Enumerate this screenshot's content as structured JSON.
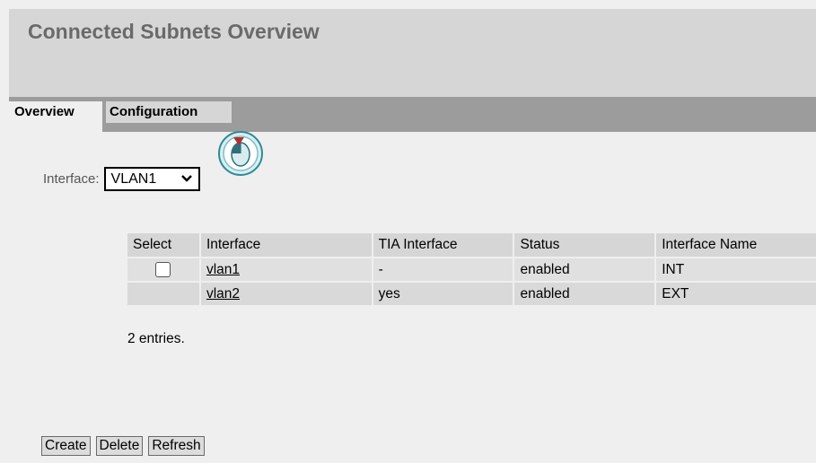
{
  "header": {
    "title": "Connected Subnets Overview"
  },
  "tabs": [
    {
      "label": "Overview",
      "active": true
    },
    {
      "label": "Configuration",
      "active": false
    }
  ],
  "interface_filter": {
    "label": "Interface:",
    "selected": "VLAN1"
  },
  "table": {
    "columns": [
      "Select",
      "Interface",
      "TIA Interface",
      "Status",
      "Interface Name"
    ],
    "rows": [
      {
        "interface": "vlan1",
        "tia": "-",
        "status": "enabled",
        "name": "INT",
        "has_checkbox": true
      },
      {
        "interface": "vlan2",
        "tia": "yes",
        "status": "enabled",
        "name": "EXT",
        "has_checkbox": false
      }
    ]
  },
  "entries_text": "2 entries.",
  "buttons": {
    "create": "Create",
    "delete": "Delete",
    "refresh": "Refresh"
  },
  "colors": {
    "header_bg": "#d6d6d6",
    "tabbar_bg": "#9c9c9c",
    "title": "#6a6a6a",
    "cursor_accent": "#b03030",
    "cursor_ring": "#2f8a99"
  },
  "icons": {
    "cursor": "mouse-click-icon",
    "dropdown": "chevron-down-icon"
  }
}
